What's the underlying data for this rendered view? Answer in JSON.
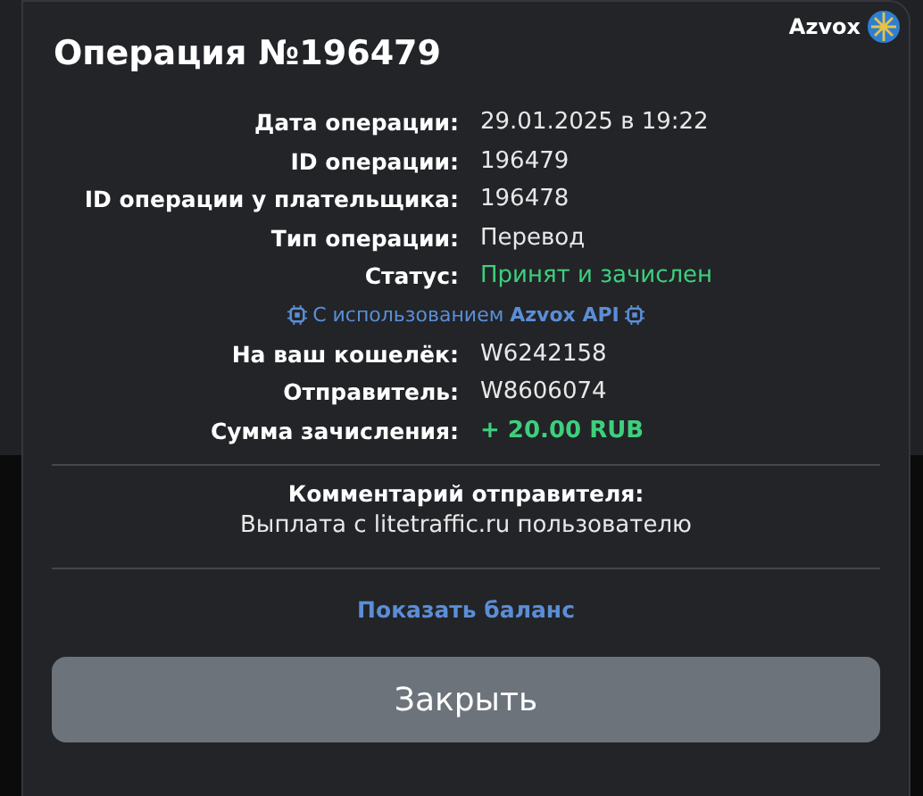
{
  "brand": {
    "name": "Azvox"
  },
  "dialog": {
    "title": "Операция №196479",
    "details": [
      {
        "label": "Дата операции:",
        "value": "29.01.2025 в 19:22",
        "kind": "plain"
      },
      {
        "label": "ID операции:",
        "value": "196479",
        "kind": "plain"
      },
      {
        "label": "ID операции у плательщика:",
        "value": "196478",
        "kind": "plain"
      },
      {
        "label": "Тип операции:",
        "value": "Перевод",
        "kind": "plain"
      },
      {
        "label": "Статус:",
        "value": "Принят и зачислен",
        "kind": "status"
      },
      {
        "kind": "api-note",
        "text": "С использованием **Azvox API**"
      },
      {
        "label": "На ваш кошелёк:",
        "value": "W6242158",
        "kind": "plain"
      },
      {
        "label": "Отправитель:",
        "value": "W8606074",
        "kind": "plain"
      },
      {
        "label": "Сумма зачисления:",
        "value": "+ 20.00 RUB",
        "kind": "amount"
      }
    ],
    "comment": {
      "label": "Комментарий отправителя:",
      "text": "Выплата с litetraffic.ru пользователю"
    },
    "link": "Показать баланс",
    "button": "Закрыть"
  }
}
